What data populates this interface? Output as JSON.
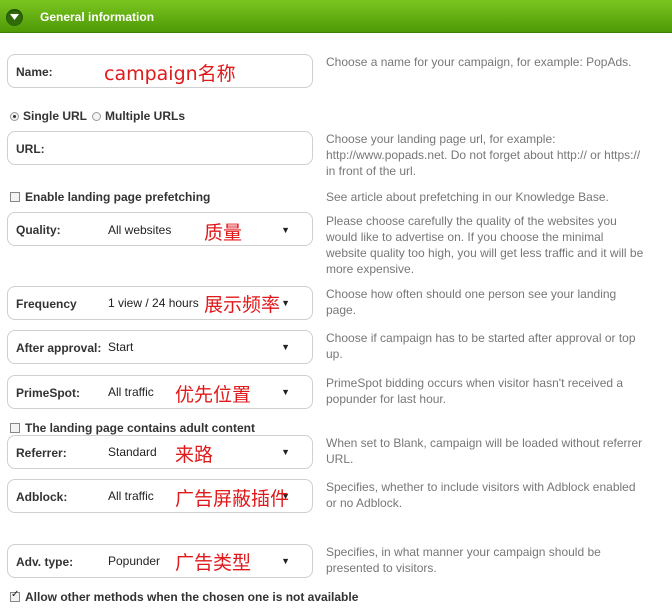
{
  "header": {
    "title": "General information"
  },
  "name_field": {
    "label": "Name:",
    "value": "campaign名称",
    "help": "Choose a name for your campaign, for example: PopAds."
  },
  "url_mode": {
    "single": "Single URL",
    "multiple": "Multiple URLs",
    "selected": "single"
  },
  "url_field": {
    "label": "URL:",
    "help": "Choose your landing page url, for example: http://www.popads.net. Do not forget about http:// or https:// in front of the url."
  },
  "prefetch": {
    "label": "Enable landing page prefetching",
    "help": "See article about prefetching in our Knowledge Base.",
    "checked": false
  },
  "quality": {
    "label": "Quality:",
    "value": "All websites",
    "note": "质量",
    "help": "Please choose carefully the quality of the websites you would like to advertise on. If you choose the minimal website quality too high, you will get less traffic and it will be more expensive."
  },
  "frequency": {
    "label": "Frequency",
    "value": "1 view / 24 hours",
    "note": "展示频率",
    "help": "Choose how often should one person see your landing page."
  },
  "after_approval": {
    "label": "After approval:",
    "value": "Start",
    "help": "Choose if campaign has to be started after approval or top up."
  },
  "primespot": {
    "label": "PrimeSpot:",
    "value": "All traffic",
    "note": "优先位置",
    "help": "PrimeSpot bidding occurs when visitor hasn't received a popunder for last hour."
  },
  "adult": {
    "label": "The landing page contains adult content",
    "checked": false
  },
  "referrer": {
    "label": "Referrer:",
    "value": "Standard",
    "note": "来路",
    "help": "When set to Blank, campaign will be loaded without referrer URL."
  },
  "adblock": {
    "label": "Adblock:",
    "value": "All traffic",
    "note": "广告屏蔽插件",
    "help": "Specifies, whether to include visitors with Adblock enabled or no Adblock."
  },
  "adv_type": {
    "label": "Adv. type:",
    "value": "Popunder",
    "note": "广告类型",
    "help": "Specifies, in what manner your campaign should be presented to visitors."
  },
  "allow_other": {
    "label": "Allow other methods when the chosen one is not available",
    "checked": true
  },
  "icons": {
    "toggle": "chevron-down-icon",
    "dropdown": "triangle-down-icon"
  },
  "colors": {
    "header_top": "#7cc520",
    "header_bottom": "#4d9a06",
    "annotation": "#e0191b"
  }
}
